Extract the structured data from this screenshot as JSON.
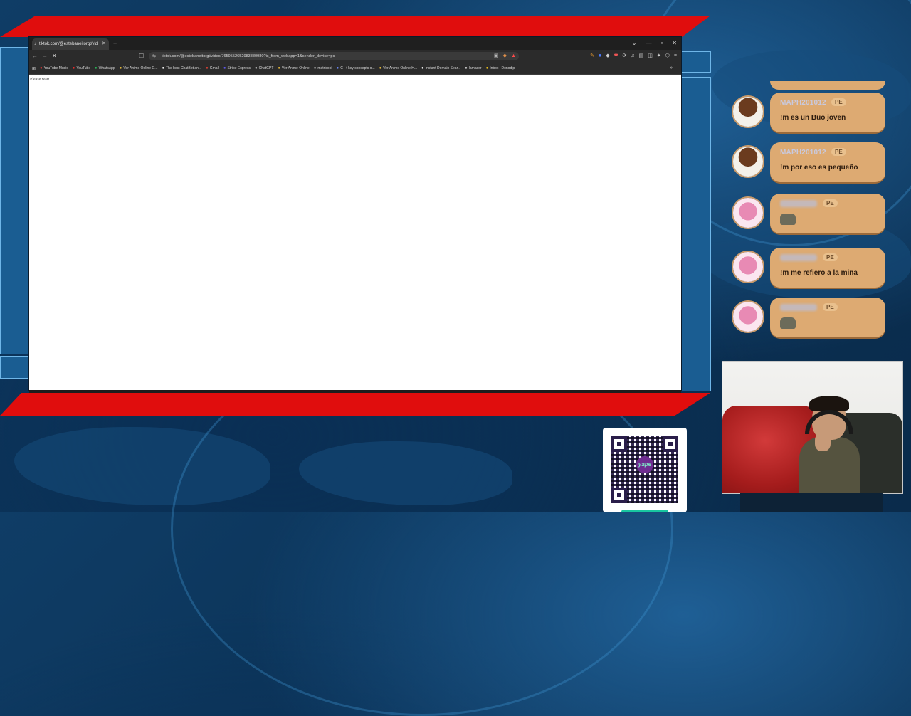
{
  "browser": {
    "tab_title": "tiktok.com/@estebaneitorgt/vid",
    "url": "tiktok.com/@estebaneitorgt/video/7659552652983880980?is_from_webapp=1&sender_device=pc",
    "page_text": "Please wait...",
    "bookmarks": [
      {
        "label": "YouTube Music",
        "icon": "youtube-music-icon",
        "color": "#ff3b3b"
      },
      {
        "label": "YouTube",
        "icon": "youtube-icon",
        "color": "#ff2a2a"
      },
      {
        "label": "WhatsApp",
        "icon": "whatsapp-icon",
        "color": "#29c35a"
      },
      {
        "label": "Ver Anime Online G...",
        "icon": "anime-icon",
        "color": "#f2c23a"
      },
      {
        "label": "The best ChatBot an...",
        "icon": "chatbot-icon",
        "color": "#ffffff"
      },
      {
        "label": "Gmail",
        "icon": "gmail-icon",
        "color": "#ea4335"
      },
      {
        "label": "Stripe Express",
        "icon": "stripe-icon",
        "color": "#635bff"
      },
      {
        "label": "ChatGPT",
        "icon": "chatgpt-icon",
        "color": "#dddddd"
      },
      {
        "label": "Ver Anime Online",
        "icon": "anime-icon",
        "color": "#f2c23a"
      },
      {
        "label": "metricool",
        "icon": "metricool-icon",
        "color": "#dddddd"
      },
      {
        "label": "C++ key concepts o...",
        "icon": "cpp-icon",
        "color": "#6c8cff"
      },
      {
        "label": "Ver Anime Online H...",
        "icon": "anime-icon",
        "color": "#f2c23a"
      },
      {
        "label": "Instant Domain Sear...",
        "icon": "domain-icon",
        "color": "#ffffff"
      },
      {
        "label": "lamasor",
        "icon": "globe-icon",
        "color": "#dddddd"
      },
      {
        "label": "Inbox | Donodip",
        "icon": "inbox-icon",
        "color": "#f5c518"
      }
    ]
  },
  "chat": {
    "messages": [
      {
        "user": "MAPH201012",
        "badge": "PE",
        "text": "!m es un Buo joven",
        "avatar": "brown",
        "emote": false,
        "blurred": false
      },
      {
        "user": "MAPH201012",
        "badge": "PE",
        "text": "!m por eso es pequeño",
        "avatar": "brown",
        "emote": false,
        "blurred": false
      },
      {
        "user": "",
        "badge": "PE",
        "text": "",
        "avatar": "pink",
        "emote": true,
        "blurred": true
      },
      {
        "user": "",
        "badge": "PE",
        "text": "!m me refiero a la mina",
        "avatar": "pink",
        "emote": false,
        "blurred": true
      },
      {
        "user": "",
        "badge": "PE",
        "text": "",
        "avatar": "pink",
        "emote": true,
        "blurred": true
      }
    ]
  },
  "qr": {
    "logo_text": "yape"
  },
  "colors": {
    "banner": "#e00d0d",
    "bubble": "#ddaa72",
    "background": "#0f3d66"
  }
}
